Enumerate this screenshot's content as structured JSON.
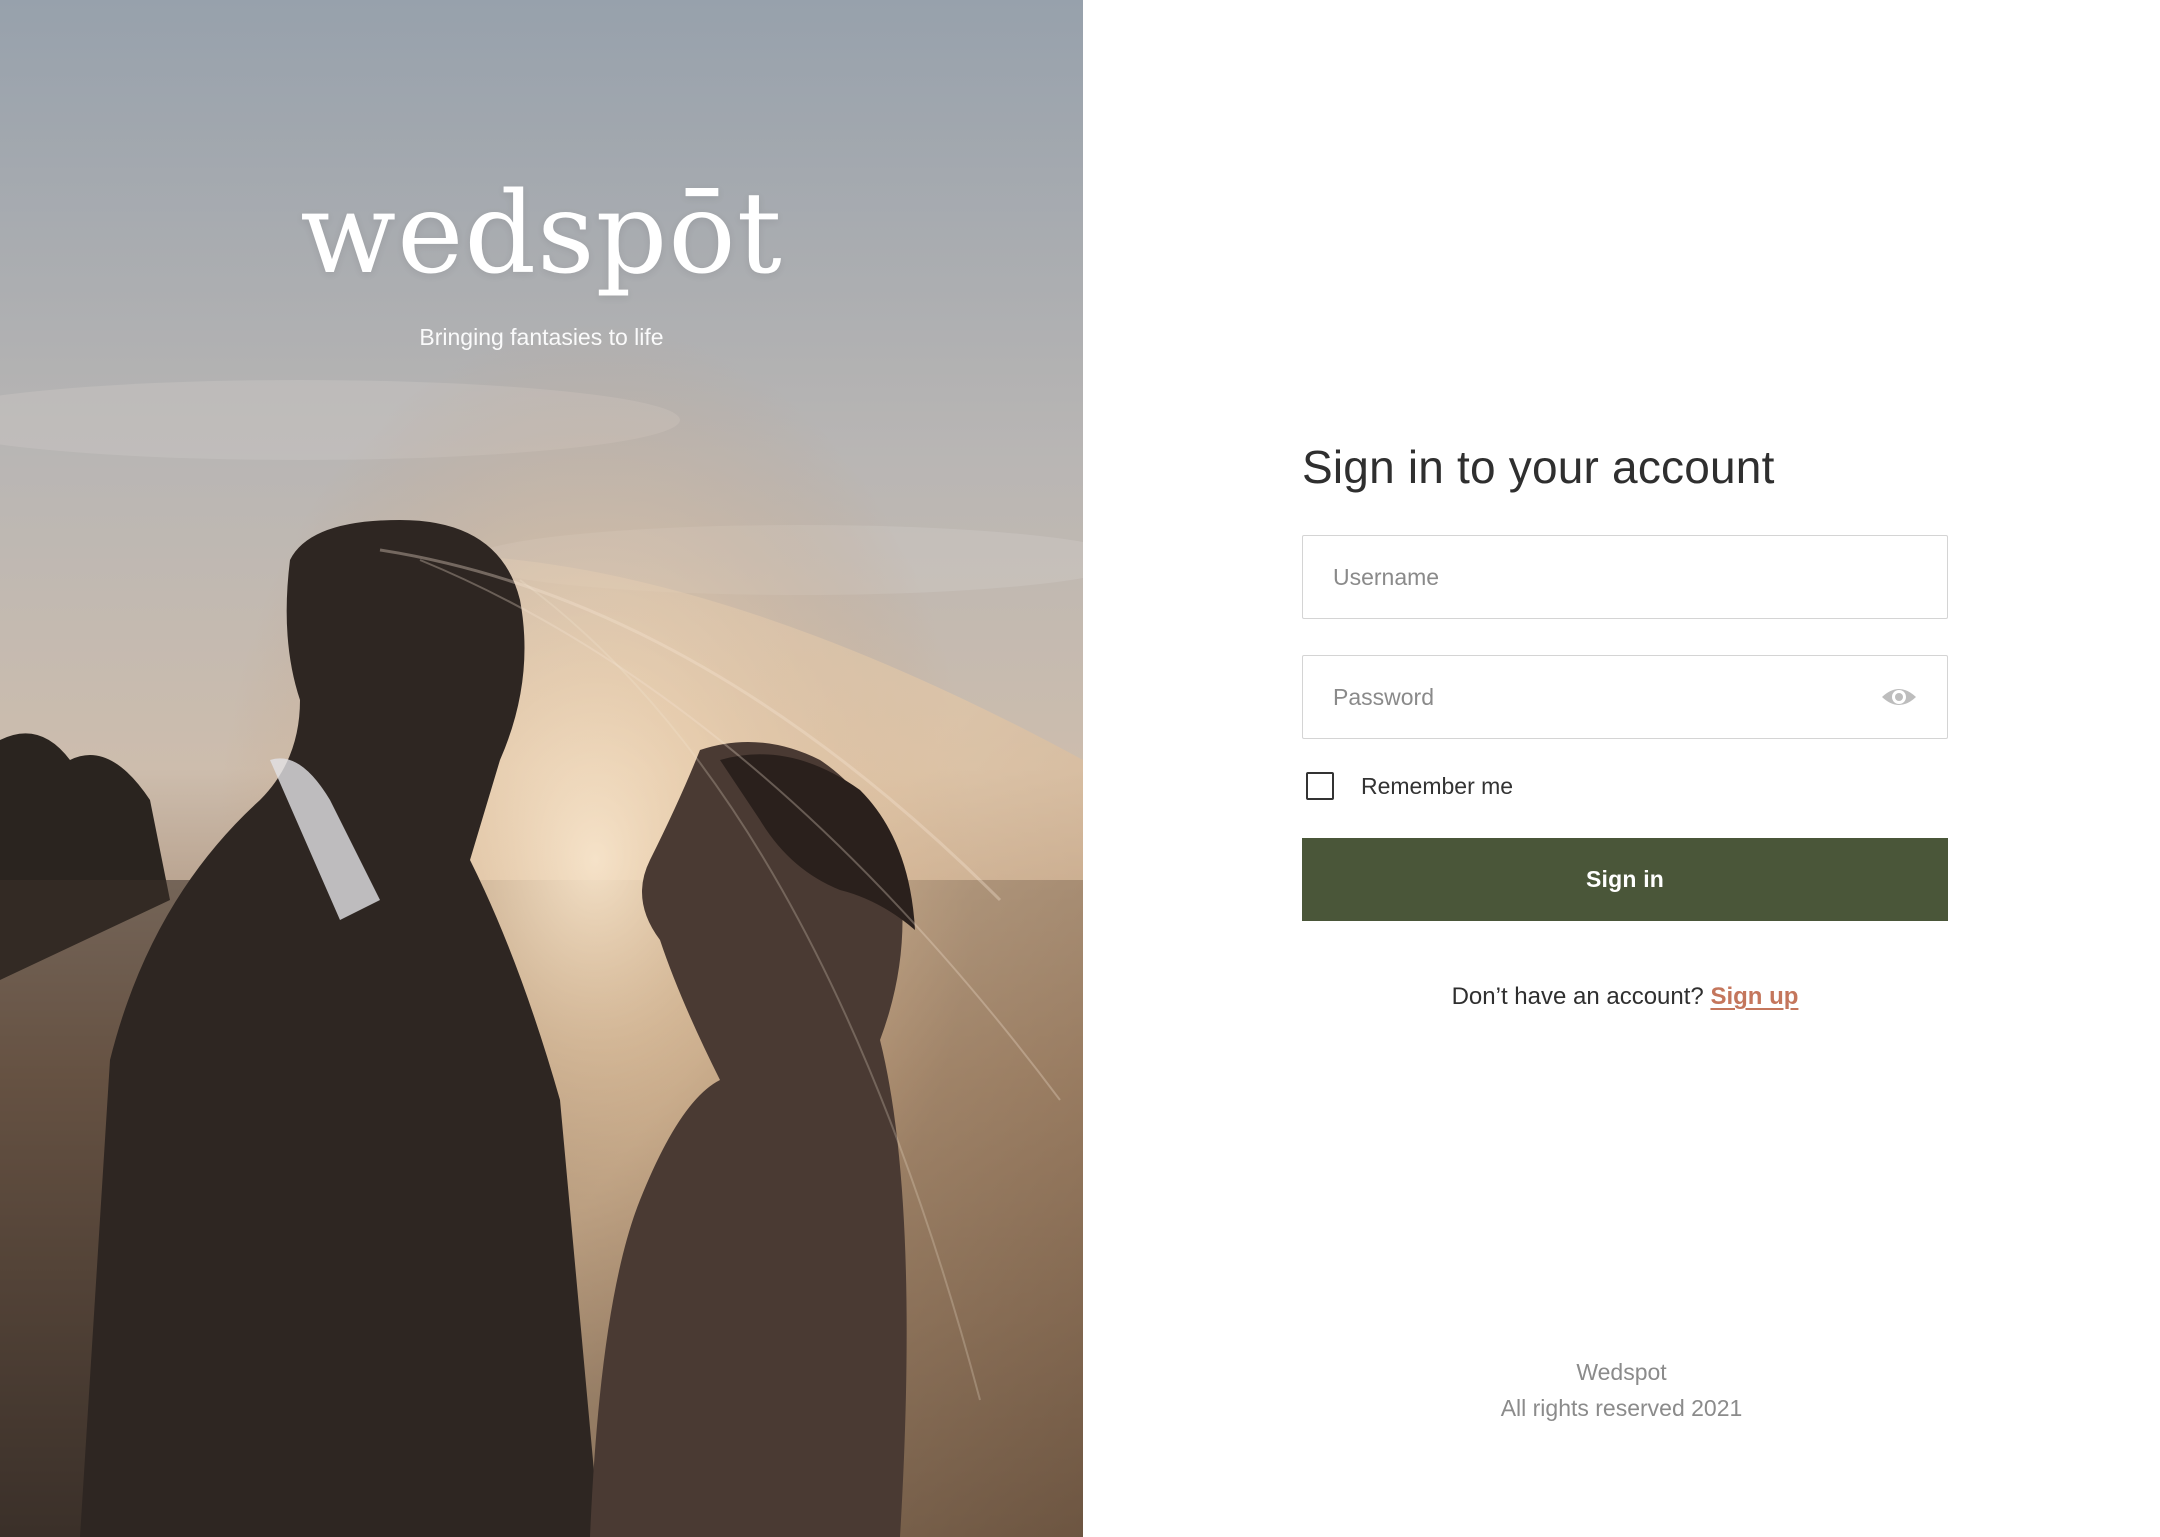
{
  "brand": {
    "logo": "wedspōt",
    "tagline": "Bringing fantasies to life"
  },
  "signin": {
    "title": "Sign in to your account",
    "username_placeholder": "Username",
    "password_placeholder": "Password",
    "remember_label": "Remember me",
    "remember_checked": false,
    "submit_label": "Sign in",
    "no_account_text": "Don’t have an account?",
    "signup_label": "Sign up",
    "password_toggle_icon": "eye-icon"
  },
  "footer": {
    "line1": "Wedspot",
    "line2": "All rights reserved 2021"
  },
  "colors": {
    "primary_button": "#4a5639",
    "link": "#c4765c",
    "text": "#2f2f2f",
    "muted": "#8b8b8b"
  }
}
